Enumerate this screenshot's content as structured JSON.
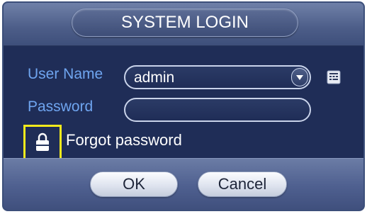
{
  "dialog": {
    "title": "SYSTEM LOGIN"
  },
  "form": {
    "username_label": "User Name",
    "username_value": "admin",
    "password_label": "Password",
    "password_value": "",
    "forgot_label": "Forgot password"
  },
  "buttons": {
    "ok_label": "OK",
    "cancel_label": "Cancel"
  },
  "icons": {
    "dropdown": "chevron-down-icon",
    "keyboard": "keyboard-icon",
    "lock": "lock-icon"
  },
  "colors": {
    "label": "#6fa5f0",
    "highlight_box": "#f4ea1c",
    "panel": "#1f2d57"
  }
}
